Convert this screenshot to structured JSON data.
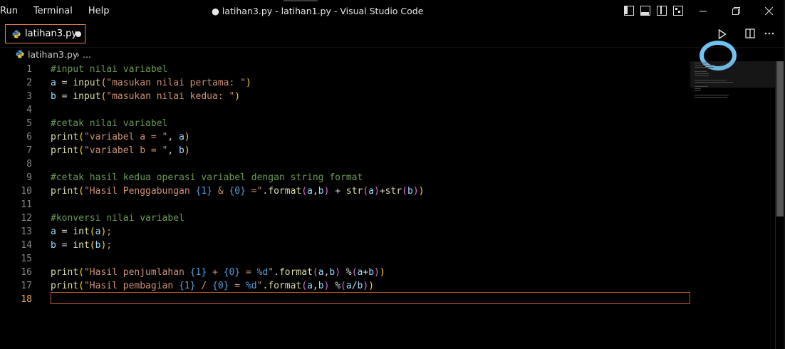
{
  "menu": [
    "Run",
    "Terminal",
    "Help"
  ],
  "window_title": "● latihan3.py - latihan1.py - Visual Studio Code",
  "tab": {
    "label": "latihan3.py"
  },
  "breadcrumb": {
    "file": "latihan3.py",
    "rest": "› ..."
  },
  "colors": {
    "comment": "#6a9955",
    "string": "#ce9178",
    "function": "#dcdcaa",
    "variable": "#9cdcfe",
    "placeholder": "#569cd6",
    "highlight": "#6ec3f0",
    "tab_border": "#e8864a"
  },
  "icons": [
    "python-file-icon",
    "run-python-file-icon",
    "split-editor-icon",
    "more-actions-icon",
    "minimize-icon",
    "restore-icon",
    "close-icon"
  ],
  "editor": {
    "active_line": 18,
    "lines": [
      {
        "n": "1",
        "tokens": [
          [
            "c",
            "#input nilai variabel"
          ]
        ]
      },
      {
        "n": "2",
        "tokens": [
          [
            "v",
            "a"
          ],
          [
            "p",
            " = "
          ],
          [
            "f",
            "input"
          ],
          [
            "b1",
            "("
          ],
          [
            "s",
            "\"masukan nilai pertama: \""
          ],
          [
            "b1",
            ")"
          ]
        ]
      },
      {
        "n": "3",
        "tokens": [
          [
            "v",
            "b"
          ],
          [
            "p",
            " = "
          ],
          [
            "f",
            "input"
          ],
          [
            "b1",
            "("
          ],
          [
            "s",
            "\"masukan nilai kedua: \""
          ],
          [
            "b1",
            ")"
          ]
        ]
      },
      {
        "n": "4",
        "tokens": []
      },
      {
        "n": "5",
        "tokens": [
          [
            "c",
            "#cetak nilai variabel"
          ]
        ]
      },
      {
        "n": "6",
        "tokens": [
          [
            "f",
            "print"
          ],
          [
            "b1",
            "("
          ],
          [
            "s",
            "\"variabel a = \""
          ],
          [
            "p",
            ", "
          ],
          [
            "v",
            "a"
          ],
          [
            "b1",
            ")"
          ]
        ]
      },
      {
        "n": "7",
        "tokens": [
          [
            "f",
            "print"
          ],
          [
            "b1",
            "("
          ],
          [
            "s",
            "\"variabel b = \""
          ],
          [
            "p",
            ", "
          ],
          [
            "v",
            "b"
          ],
          [
            "b1",
            ")"
          ]
        ]
      },
      {
        "n": "8",
        "tokens": []
      },
      {
        "n": "9",
        "tokens": [
          [
            "c",
            "#cetak hasil kedua operasi variabel dengan string format"
          ]
        ]
      },
      {
        "n": "10",
        "tokens": [
          [
            "f",
            "print"
          ],
          [
            "b1",
            "("
          ],
          [
            "s",
            "\"Hasil Penggabungan "
          ],
          [
            "h",
            "{1}"
          ],
          [
            "s",
            " & "
          ],
          [
            "h",
            "{0}"
          ],
          [
            "s",
            " =\""
          ],
          [
            "p",
            "."
          ],
          [
            "f",
            "format"
          ],
          [
            "b2",
            "("
          ],
          [
            "v",
            "a"
          ],
          [
            "p",
            ","
          ],
          [
            "v",
            "b"
          ],
          [
            "b2",
            ")"
          ],
          [
            "p",
            " + "
          ],
          [
            "f",
            "str"
          ],
          [
            "b2",
            "("
          ],
          [
            "v",
            "a"
          ],
          [
            "b2",
            ")"
          ],
          [
            "p",
            "+"
          ],
          [
            "f",
            "str"
          ],
          [
            "b2",
            "("
          ],
          [
            "v",
            "b"
          ],
          [
            "b2",
            ")"
          ],
          [
            "b1",
            ")"
          ]
        ]
      },
      {
        "n": "11",
        "tokens": []
      },
      {
        "n": "12",
        "tokens": [
          [
            "c",
            "#konversi nilai variabel"
          ]
        ]
      },
      {
        "n": "13",
        "tokens": [
          [
            "v",
            "a"
          ],
          [
            "p",
            " = "
          ],
          [
            "f",
            "int"
          ],
          [
            "b1",
            "("
          ],
          [
            "v",
            "a"
          ],
          [
            "b1",
            ")"
          ],
          [
            "s",
            ";"
          ]
        ]
      },
      {
        "n": "14",
        "tokens": [
          [
            "v",
            "b"
          ],
          [
            "p",
            " = "
          ],
          [
            "f",
            "int"
          ],
          [
            "b1",
            "("
          ],
          [
            "v",
            "b"
          ],
          [
            "b1",
            ")"
          ],
          [
            "s",
            ";"
          ]
        ]
      },
      {
        "n": "15",
        "tokens": []
      },
      {
        "n": "16",
        "tokens": [
          [
            "f",
            "print"
          ],
          [
            "b1",
            "("
          ],
          [
            "s",
            "\"Hasil penjumlahan "
          ],
          [
            "h",
            "{1}"
          ],
          [
            "s",
            " + "
          ],
          [
            "h",
            "{0}"
          ],
          [
            "s",
            " = "
          ],
          [
            "h",
            "%d"
          ],
          [
            "s",
            "\""
          ],
          [
            "p",
            "."
          ],
          [
            "f",
            "format"
          ],
          [
            "b2",
            "("
          ],
          [
            "v",
            "a"
          ],
          [
            "p",
            ","
          ],
          [
            "v",
            "b"
          ],
          [
            "b2",
            ")"
          ],
          [
            "p",
            " %"
          ],
          [
            "b2",
            "("
          ],
          [
            "v",
            "a"
          ],
          [
            "p",
            "+"
          ],
          [
            "v",
            "b"
          ],
          [
            "b2",
            ")"
          ],
          [
            "b1",
            ")"
          ]
        ]
      },
      {
        "n": "17",
        "tokens": [
          [
            "f",
            "print"
          ],
          [
            "b1",
            "("
          ],
          [
            "s",
            "\"Hasil pembagian "
          ],
          [
            "h",
            "{1}"
          ],
          [
            "s",
            " / "
          ],
          [
            "h",
            "{0}"
          ],
          [
            "s",
            " = "
          ],
          [
            "h",
            "%d"
          ],
          [
            "s",
            "\""
          ],
          [
            "p",
            "."
          ],
          [
            "f",
            "format"
          ],
          [
            "b2",
            "("
          ],
          [
            "v",
            "a"
          ],
          [
            "p",
            ","
          ],
          [
            "v",
            "b"
          ],
          [
            "b2",
            ")"
          ],
          [
            "p",
            " %"
          ],
          [
            "b2",
            "("
          ],
          [
            "v",
            "a"
          ],
          [
            "p",
            "/"
          ],
          [
            "v",
            "b"
          ],
          [
            "b2",
            ")"
          ],
          [
            "b1",
            ")"
          ]
        ]
      },
      {
        "n": "18",
        "tokens": []
      }
    ]
  }
}
